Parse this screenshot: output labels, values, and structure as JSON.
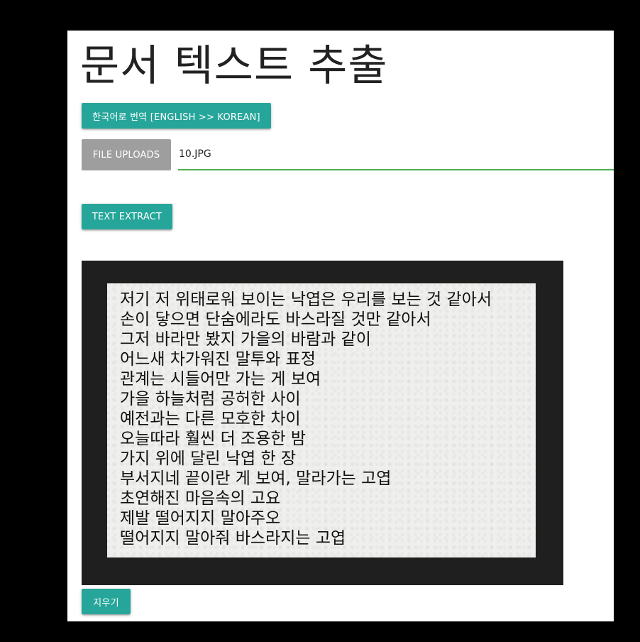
{
  "page": {
    "title": "문서 텍스트 추출"
  },
  "buttons": {
    "translate_label": "한국어로 번역 [ENGLISH >> KOREAN]",
    "upload_label": "FILE UPLOADS",
    "extract_label": "TEXT EXTRACT",
    "clear_label": "지우기"
  },
  "file": {
    "name": "10.JPG"
  },
  "preview": {
    "lines": [
      "저기 저 위태로워 보이는 낙엽은 우리를 보는 것 같아서",
      "손이 닿으면 단숨에라도 바스라질 것만 같아서",
      "그저 바라만 봤지 가을의 바람과 같이",
      "어느새 차가워진 말투와 표정",
      "관계는 시들어만 가는 게 보여",
      "가을 하늘처럼 공허한 사이",
      "예전과는 다른 모호한 차이",
      "오늘따라 훨씬 더 조용한 밤",
      "가지 위에 달린 낙엽 한 장",
      "부서지네 끝이란 게 보여, 말라가는 고엽",
      "초연해진 마음속의 고요",
      "제발 떨어지지 말아주오",
      "떨어지지 말아줘 바스라지는 고엽"
    ]
  },
  "colors": {
    "accent": "#26a69a",
    "upload_button": "#9e9e9e",
    "input_underline": "#4caf50",
    "frame": "#1f1f1f"
  }
}
